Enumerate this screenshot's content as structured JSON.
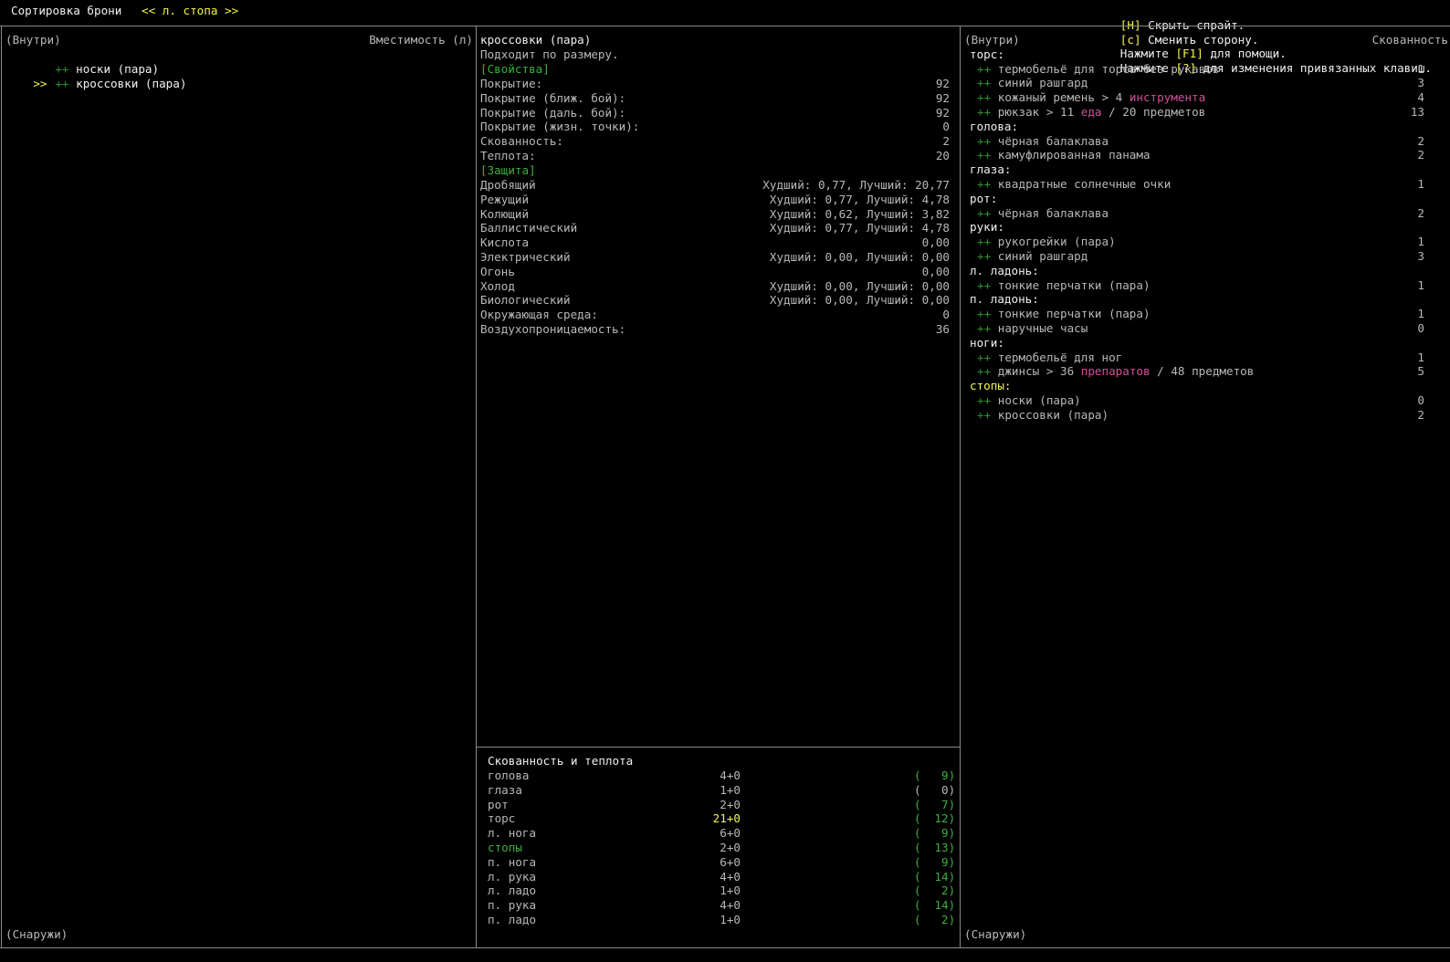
{
  "topbar": {
    "title": "Сортировка брони",
    "side_selector": "<< л. стопа >>",
    "hints": [
      {
        "key": "[H]",
        "text": " Скрыть спрайт."
      },
      {
        "key": "[c]",
        "text": " Сменить сторону."
      },
      {
        "pre": "Нажмите ",
        "key": "[F1]",
        "text": " для помощи."
      },
      {
        "pre": "Нажмите ",
        "key": "[?]",
        "text": " для изменения привязанных клавиш."
      }
    ]
  },
  "left_panel": {
    "header_left": "(Внутри)",
    "header_right": "Вместимость (л)",
    "items": [
      {
        "cursor": "",
        "marker": "++",
        "label": "носки (пара)"
      },
      {
        "cursor": ">>",
        "marker": "++",
        "label": "кроссовки (пара)"
      }
    ],
    "footer": "(Снаружи)"
  },
  "middle_panel": {
    "title": "кроссовки (пара)",
    "subtitle": "Подходит по размеру.",
    "props_header": "[Свойства]",
    "props": [
      {
        "label": "Покрытие:",
        "value": "92"
      },
      {
        "label": "Покрытие (ближ. бой):",
        "value": "92"
      },
      {
        "label": "Покрытие (даль. бой):",
        "value": "92"
      },
      {
        "label": "Покрытие (жизн. точки):",
        "value": "0"
      },
      {
        "label": "Скованность:",
        "value": "2"
      },
      {
        "label": "Теплота:",
        "value": "20"
      }
    ],
    "protection_header": "[Защита]",
    "protection": [
      {
        "label": "Дробящий",
        "value": "Худший: 0,77, Лучший: 20,77"
      },
      {
        "label": "Режущий",
        "value": "Худший: 0,77, Лучший: 4,78"
      },
      {
        "label": "Колющий",
        "value": "Худший: 0,62, Лучший: 3,82"
      },
      {
        "label": "Баллистический",
        "value": "Худший: 0,77, Лучший: 4,78"
      },
      {
        "label": "Кислота",
        "value": "0,00"
      },
      {
        "label": "Электрический",
        "value": "Худший: 0,00, Лучший: 0,00"
      },
      {
        "label": "Огонь",
        "value": "0,00"
      },
      {
        "label": "Холод",
        "value": "Худший: 0,00, Лучший: 0,00"
      },
      {
        "label": "Биологический",
        "value": "Худший: 0,00, Лучший: 0,00"
      },
      {
        "label": "Окружающая среда:",
        "value": "0"
      },
      {
        "label": "Воздухопроницаемость:",
        "value": "36"
      }
    ]
  },
  "encumbrance_panel": {
    "title": "Скованность и теплота",
    "rows": [
      {
        "part": "голова",
        "enc": "4+0",
        "warmth": "9",
        "enc_color": "gray",
        "part_color": "gray",
        "warm_color": "green"
      },
      {
        "part": "глаза",
        "enc": "1+0",
        "warmth": "0",
        "enc_color": "gray",
        "part_color": "gray",
        "warm_color": "gray"
      },
      {
        "part": "рот",
        "enc": "2+0",
        "warmth": "7",
        "enc_color": "gray",
        "part_color": "gray",
        "warm_color": "green"
      },
      {
        "part": "торс",
        "enc": "21+0",
        "warmth": "12",
        "enc_color": "yellow",
        "part_color": "gray",
        "warm_color": "green"
      },
      {
        "part": "л. нога",
        "enc": "6+0",
        "warmth": "9",
        "enc_color": "gray",
        "part_color": "gray",
        "warm_color": "green"
      },
      {
        "part": "стопы",
        "enc": "2+0",
        "warmth": "13",
        "enc_color": "gray",
        "part_color": "green",
        "warm_color": "green"
      },
      {
        "part": "п. нога",
        "enc": "6+0",
        "warmth": "9",
        "enc_color": "gray",
        "part_color": "gray",
        "warm_color": "green"
      },
      {
        "part": "л. рука",
        "enc": "4+0",
        "warmth": "14",
        "enc_color": "gray",
        "part_color": "gray",
        "warm_color": "green"
      },
      {
        "part": "л. ладо",
        "enc": "1+0",
        "warmth": "2",
        "enc_color": "gray",
        "part_color": "gray",
        "warm_color": "green"
      },
      {
        "part": "п. рука",
        "enc": "4+0",
        "warmth": "14",
        "enc_color": "gray",
        "part_color": "gray",
        "warm_color": "green"
      },
      {
        "part": "п. ладо",
        "enc": "1+0",
        "warmth": "2",
        "enc_color": "gray",
        "part_color": "gray",
        "warm_color": "green"
      }
    ]
  },
  "right_panel": {
    "header_left": "(Внутри)",
    "header_right": "Скованность",
    "footer": "(Снаружи)",
    "groups": [
      {
        "name": "торс:",
        "highlight": false,
        "items": [
          {
            "parts": [
              {
                "t": "термобельё для торса без рукавов",
                "c": "gray"
              }
            ],
            "value": "1"
          },
          {
            "parts": [
              {
                "t": "синий рашгард",
                "c": "gray"
              }
            ],
            "value": "3"
          },
          {
            "parts": [
              {
                "t": "кожаный ремень > 4 ",
                "c": "gray"
              },
              {
                "t": "инструмента",
                "c": "pink"
              }
            ],
            "value": "4"
          },
          {
            "parts": [
              {
                "t": "рюкзак > 11 ",
                "c": "gray"
              },
              {
                "t": "еда",
                "c": "pink"
              },
              {
                "t": " / 20 предметов",
                "c": "gray"
              }
            ],
            "value": "13"
          }
        ]
      },
      {
        "name": "голова:",
        "highlight": false,
        "items": [
          {
            "parts": [
              {
                "t": "чёрная балаклава",
                "c": "gray"
              }
            ],
            "value": "2"
          },
          {
            "parts": [
              {
                "t": "камуфлированная панама",
                "c": "gray"
              }
            ],
            "value": "2"
          }
        ]
      },
      {
        "name": "глаза:",
        "highlight": false,
        "items": [
          {
            "parts": [
              {
                "t": "квадратные солнечные очки",
                "c": "gray"
              }
            ],
            "value": "1"
          }
        ]
      },
      {
        "name": "рот:",
        "highlight": false,
        "items": [
          {
            "parts": [
              {
                "t": "чёрная балаклава",
                "c": "gray"
              }
            ],
            "value": "2"
          }
        ]
      },
      {
        "name": "руки:",
        "highlight": false,
        "items": [
          {
            "parts": [
              {
                "t": "рукогрейки (пара)",
                "c": "gray"
              }
            ],
            "value": "1"
          },
          {
            "parts": [
              {
                "t": "синий рашгард",
                "c": "gray"
              }
            ],
            "value": "3"
          }
        ]
      },
      {
        "name": "л. ладонь:",
        "highlight": false,
        "items": [
          {
            "parts": [
              {
                "t": "тонкие перчатки (пара)",
                "c": "gray"
              }
            ],
            "value": "1"
          }
        ]
      },
      {
        "name": "п. ладонь:",
        "highlight": false,
        "items": [
          {
            "parts": [
              {
                "t": "тонкие перчатки (пара)",
                "c": "gray"
              }
            ],
            "value": "1"
          },
          {
            "parts": [
              {
                "t": "наручные часы",
                "c": "gray"
              }
            ],
            "value": "0"
          }
        ]
      },
      {
        "name": "ноги:",
        "highlight": false,
        "items": [
          {
            "parts": [
              {
                "t": "термобельё для ног",
                "c": "gray"
              }
            ],
            "value": "1"
          },
          {
            "parts": [
              {
                "t": "джинсы > 36 ",
                "c": "gray"
              },
              {
                "t": "препаратов",
                "c": "pink"
              },
              {
                "t": " / 48 предметов",
                "c": "gray"
              }
            ],
            "value": "5"
          }
        ]
      },
      {
        "name": "стопы:",
        "highlight": true,
        "items": [
          {
            "parts": [
              {
                "t": "носки (пара)",
                "c": "gray"
              }
            ],
            "value": "0"
          },
          {
            "parts": [
              {
                "t": "кроссовки (пара)",
                "c": "gray"
              }
            ],
            "value": "2"
          }
        ]
      }
    ]
  }
}
